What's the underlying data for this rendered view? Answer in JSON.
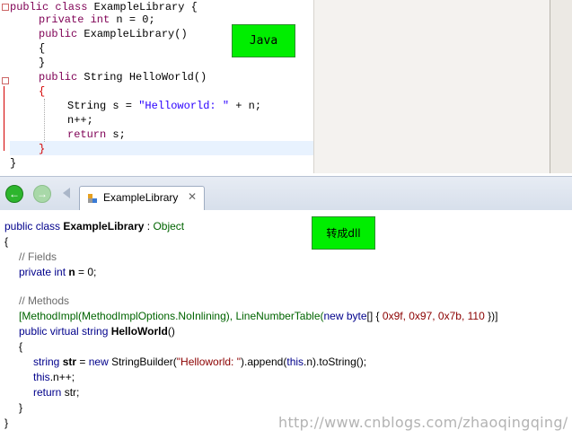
{
  "java": {
    "badge": "Java",
    "lines": [
      {
        "kw": "public class ",
        "rest": "ExampleLibrary {"
      },
      {
        "kw": "private int ",
        "rest": "n = ",
        "num": "0",
        ";": ";"
      },
      {
        "kw": "public ",
        "rest": "ExampleLibrary()"
      },
      {
        "text": "{"
      },
      {
        "text": "}"
      },
      {
        "kw": "public ",
        "rest": "String HelloWorld()"
      },
      {
        "text": "{"
      },
      {
        "pre": "String s = ",
        "str": "\"Helloworld: \"",
        "post": " + n;"
      },
      {
        "text": "n++;"
      },
      {
        "kw": "return ",
        "rest": "s;"
      },
      {
        "text": "}"
      },
      {
        "text": "}"
      }
    ]
  },
  "decompiler": {
    "tab_label": "ExampleLibrary",
    "badge": "转成dll",
    "lines": {
      "l1_a": "public class ",
      "l1_b": "ExampleLibrary",
      "l1_c": " : ",
      "l1_d": "Object",
      "l2": "{",
      "l3": "// Fields",
      "l4_a": "private int ",
      "l4_b": "n",
      "l4_c": " = 0;",
      "l6": "// Methods",
      "l7_a": "[MethodImpl(MethodImplOptions.NoInlining), LineNumberTable(",
      "l7_b": "new",
      "l7_c": " ",
      "l7_d": "byte",
      "l7_e": "[] { ",
      "l7_f": "0x9f, 0x97, 0x7b, 110",
      "l7_g": " })]",
      "l8_a": "public virtual ",
      "l8_b": "string",
      "l8_c": " ",
      "l8_d": "HelloWorld",
      "l8_e": "()",
      "l9": "{",
      "l10_a": "string ",
      "l10_b": "str",
      "l10_c": " = ",
      "l10_d": "new",
      "l10_e": " StringBuilder(",
      "l10_f": "\"Helloworld: \"",
      "l10_g": ").append(",
      "l10_h": "this",
      "l10_i": ".n).toString();",
      "l11_a": "this",
      "l11_b": ".n++;",
      "l12_a": "return ",
      "l12_b": "str;",
      "l13": "}",
      "l14": "}"
    }
  },
  "watermark": "http://www.cnblogs.com/zhaoqingqing/"
}
